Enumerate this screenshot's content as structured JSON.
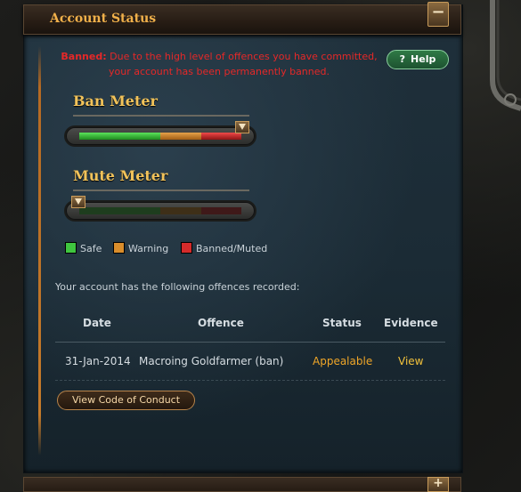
{
  "panel": {
    "title": "Account Status",
    "collapse_symbol": "−"
  },
  "notice": {
    "label": "Banned:",
    "text": "Due to the high level of offences you have committed, your account has been permanently banned."
  },
  "help_button": {
    "icon": "?",
    "label": "Help"
  },
  "ban_meter": {
    "title": "Ban Meter",
    "level": 1.0,
    "segments": [
      {
        "kind": "safe",
        "share": 0.5,
        "color": "#3fc53f"
      },
      {
        "kind": "warn",
        "share": 0.25,
        "color": "#d98d2b"
      },
      {
        "kind": "ban",
        "share": 0.25,
        "color": "#d42b2b"
      }
    ]
  },
  "mute_meter": {
    "title": "Mute Meter",
    "level": 0.0,
    "segments": [
      {
        "kind": "safe",
        "share": 0.5,
        "color": "#3fc53f"
      },
      {
        "kind": "warn",
        "share": 0.25,
        "color": "#d98d2b"
      },
      {
        "kind": "ban",
        "share": 0.25,
        "color": "#d42b2b"
      }
    ]
  },
  "legend": {
    "items": [
      {
        "label": "Safe",
        "color": "#3fc53f"
      },
      {
        "label": "Warning",
        "color": "#d98d2b"
      },
      {
        "label": "Banned/Muted",
        "color": "#d42b2b"
      }
    ]
  },
  "offences": {
    "intro": "Your account has the following offences recorded:",
    "columns": [
      "Date",
      "Offence",
      "Status",
      "Evidence"
    ],
    "rows": [
      {
        "date": "31-Jan-2014",
        "offence": "Macroing Goldfarmer (ban)",
        "status": "Appealable",
        "evidence": "View"
      }
    ]
  },
  "code_of_conduct_button": "View Code of Conduct",
  "bottom_panel": {
    "title": "",
    "expand_symbol": "+"
  },
  "colors": {
    "accent_orange": "#f0b04a",
    "banned_red": "#e62828",
    "help_green": "#2f7a46",
    "status_orange": "#f0a628",
    "link_yellow": "#f3c23b"
  }
}
